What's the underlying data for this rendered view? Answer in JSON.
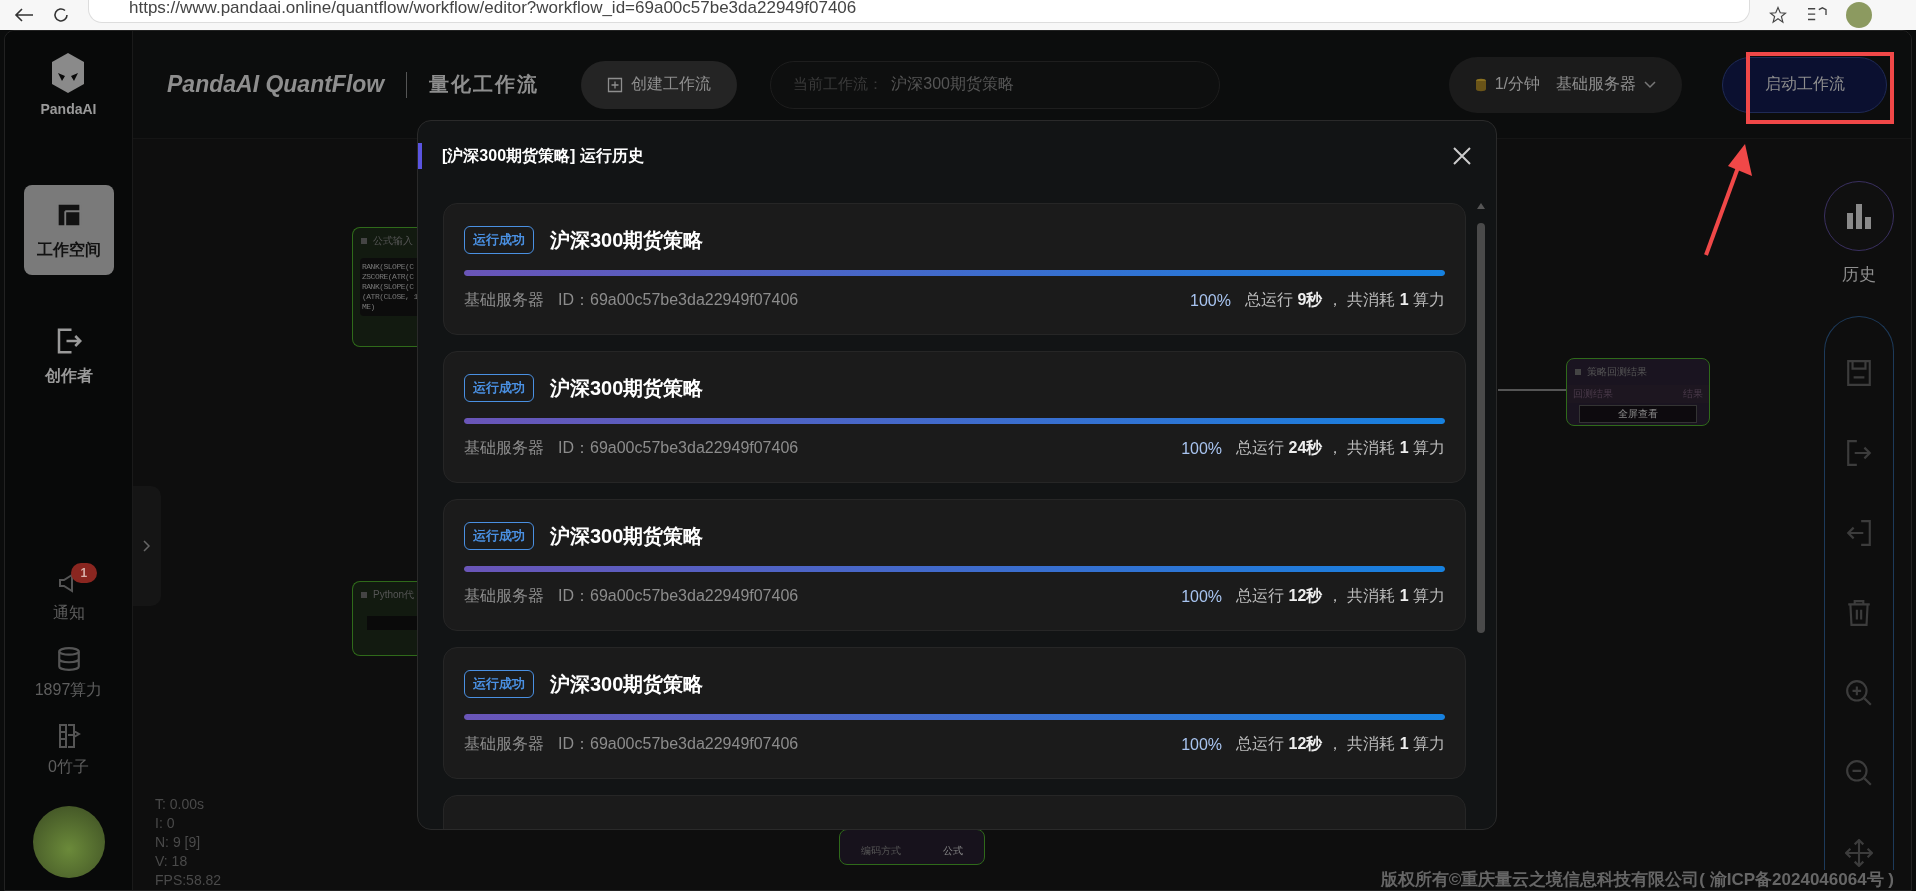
{
  "browser": {
    "url": "https://www.pandaai.online/quantflow/workflow/editor?workflow_id=69a00c57be3da22949f07406"
  },
  "sidebar": {
    "logo": "PandaAI",
    "items": [
      {
        "kind": "workspace",
        "label": "工作空间",
        "selected": true
      },
      {
        "kind": "creator",
        "label": "创作者",
        "selected": false
      },
      {
        "kind": "notice",
        "label": "通知",
        "badge": "1"
      },
      {
        "kind": "credits",
        "label": "1897算力"
      },
      {
        "kind": "bamboo",
        "label": "0竹子"
      }
    ]
  },
  "header": {
    "brand": "PandaAI QuantFlow",
    "subtitle": "量化工作流",
    "create_button": "创建工作流",
    "current_label": "当前工作流：",
    "current_value": "沪深300期货策略",
    "rate": "1/分钟",
    "server": "基础服务器",
    "start_button": "启动工作流"
  },
  "canvas": {
    "nodes": [
      {
        "kind": "formula",
        "title": "公式输入",
        "lines": [
          "RANK(SLOPE(C",
          "ZSCORE(ATR(C",
          "RANK(SLOPE(C",
          "(ATR(CLOSE, 1",
          "ME)"
        ]
      },
      {
        "kind": "python",
        "title": "Python代"
      },
      {
        "kind": "result",
        "title": "策略回测结果",
        "input": "回测结果",
        "output": "结果",
        "button": "全屏查看"
      },
      {
        "kind": "coding",
        "label": "编码方式",
        "value": "公式"
      }
    ],
    "stats": [
      "T: 0.00s",
      "I: 0",
      "N: 9 [9]",
      "V: 18",
      "FPS:58.82"
    ]
  },
  "rail": {
    "history_label": "历史"
  },
  "modal": {
    "title": "[沪深300期货策略] 运行历史",
    "runs": [
      {
        "status": "运行成功",
        "name": "沪深300期货策略",
        "level": 1,
        "server": "基础服务器",
        "id": "ID：69a00c57be3da22949f07406",
        "percent": "100%",
        "summary": "总运行 **9秒** ， 共消耗 **1** 算力"
      },
      {
        "status": "运行成功",
        "name": "沪深300期货策略",
        "level": 1,
        "server": "基础服务器",
        "id": "ID：69a00c57be3da22949f07406",
        "percent": "100%",
        "summary": "总运行 **24秒** ， 共消耗 **1** 算力"
      },
      {
        "status": "运行成功",
        "name": "沪深300期货策略",
        "level": 1,
        "server": "基础服务器",
        "id": "ID：69a00c57be3da22949f07406",
        "percent": "100%",
        "summary": "总运行 **12秒** ， 共消耗 **1** 算力"
      },
      {
        "status": "运行成功",
        "name": "沪深300期货策略",
        "level": 1,
        "server": "基础服务器",
        "id": "ID：69a00c57be3da22949f07406",
        "percent": "100%",
        "summary": "总运行 **12秒** ， 共消耗 **1** 算力"
      }
    ]
  },
  "footer": "版权所有©重庆量云之境信息科技有限公司( 渝ICP备2024046064号 )"
}
